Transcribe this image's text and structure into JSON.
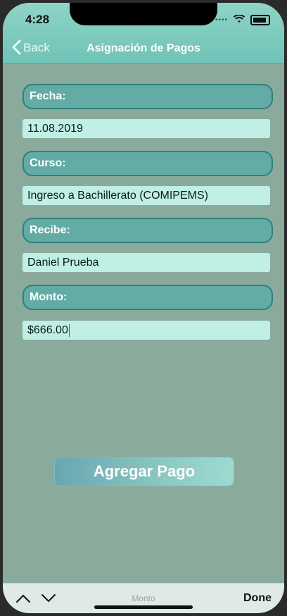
{
  "status_bar": {
    "time": "4:28",
    "signal_icon": "signal-dots-icon",
    "wifi_icon": "wifi-icon",
    "battery_icon": "battery-icon"
  },
  "nav": {
    "back_label": "Back",
    "title": "Asignación de Pagos"
  },
  "form": {
    "fecha_label": "Fecha:",
    "fecha_value": "11.08.2019",
    "curso_label": "Curso:",
    "curso_value": "Ingreso a Bachillerato (COMIPEMS)",
    "recibe_label": "Recibe:",
    "recibe_value": "Daniel Prueba",
    "monto_label": "Monto:",
    "monto_value": "$666.00"
  },
  "actions": {
    "submit_label": "Agregar Pago"
  },
  "keyboard_accessory": {
    "title": "Monto",
    "done_label": "Done"
  },
  "colors": {
    "header": "#6fc3b6",
    "background": "#8aaa9c",
    "label_bg": "#63aca6",
    "input_bg": "#bfefe5"
  }
}
